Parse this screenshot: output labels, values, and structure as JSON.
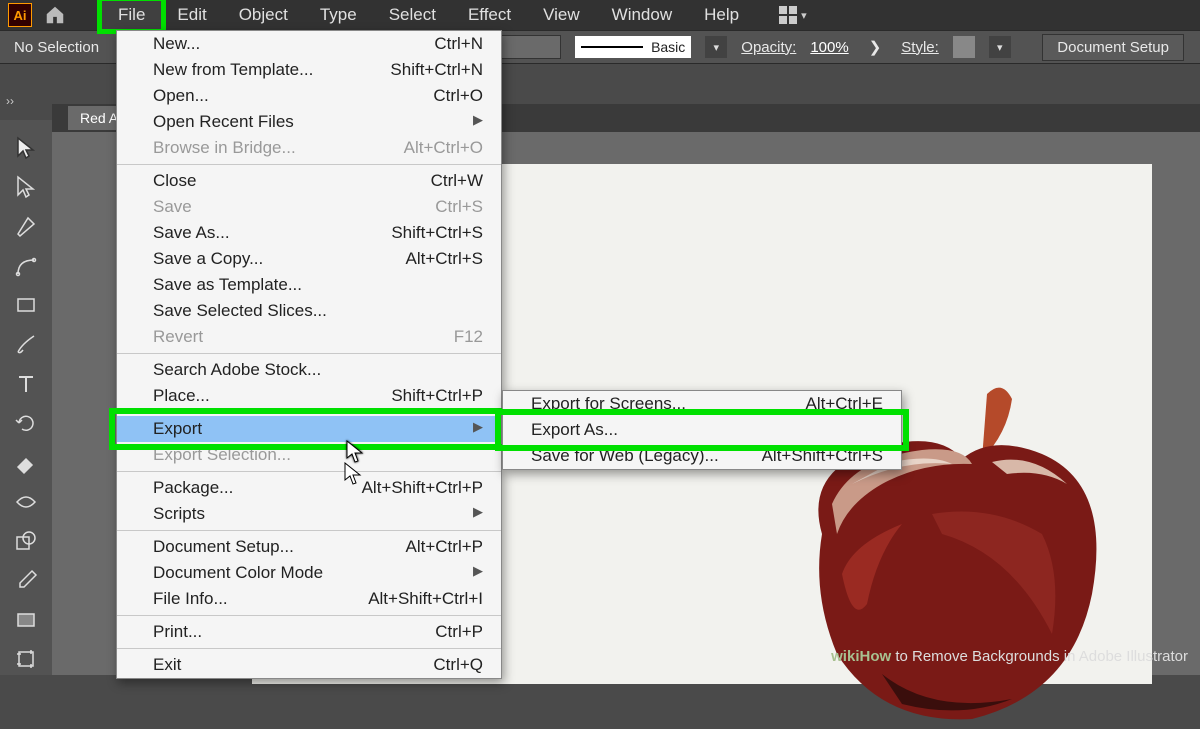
{
  "menubar": [
    "File",
    "Edit",
    "Object",
    "Type",
    "Select",
    "Effect",
    "View",
    "Window",
    "Help"
  ],
  "selection": "No Selection",
  "options": {
    "stroke_style": "Basic",
    "opacity_label": "Opacity:",
    "opacity_value": "100%",
    "style_label": "Style:",
    "doc_setup": "Document Setup"
  },
  "tab_name": "Red Ap",
  "file_menu": [
    {
      "label": "New...",
      "sc": "Ctrl+N"
    },
    {
      "label": "New from Template...",
      "sc": "Shift+Ctrl+N"
    },
    {
      "label": "Open...",
      "sc": "Ctrl+O"
    },
    {
      "label": "Open Recent Files",
      "sc": "",
      "arrow": true
    },
    {
      "label": "Browse in Bridge...",
      "sc": "Alt+Ctrl+O",
      "disabled": true
    },
    {
      "sep": true
    },
    {
      "label": "Close",
      "sc": "Ctrl+W"
    },
    {
      "label": "Save",
      "sc": "Ctrl+S",
      "disabled": true
    },
    {
      "label": "Save As...",
      "sc": "Shift+Ctrl+S"
    },
    {
      "label": "Save a Copy...",
      "sc": "Alt+Ctrl+S"
    },
    {
      "label": "Save as Template...",
      "sc": ""
    },
    {
      "label": "Save Selected Slices...",
      "sc": ""
    },
    {
      "label": "Revert",
      "sc": "F12",
      "disabled": true
    },
    {
      "sep": true
    },
    {
      "label": "Search Adobe Stock...",
      "sc": ""
    },
    {
      "label": "Place...",
      "sc": "Shift+Ctrl+P"
    },
    {
      "sep": true
    },
    {
      "label": "Export",
      "sc": "",
      "arrow": true,
      "hl": true
    },
    {
      "label": "Export Selection...",
      "sc": "",
      "disabled": true
    },
    {
      "sep": true
    },
    {
      "label": "Package...",
      "sc": "Alt+Shift+Ctrl+P"
    },
    {
      "label": "Scripts",
      "sc": "",
      "arrow": true
    },
    {
      "sep": true
    },
    {
      "label": "Document Setup...",
      "sc": "Alt+Ctrl+P"
    },
    {
      "label": "Document Color Mode",
      "sc": "",
      "arrow": true
    },
    {
      "label": "File Info...",
      "sc": "Alt+Shift+Ctrl+I"
    },
    {
      "sep": true
    },
    {
      "label": "Print...",
      "sc": "Ctrl+P"
    },
    {
      "sep": true
    },
    {
      "label": "Exit",
      "sc": "Ctrl+Q"
    }
  ],
  "export_submenu": [
    {
      "label": "Export for Screens...",
      "sc": "Alt+Ctrl+E"
    },
    {
      "label": "Export As...",
      "sc": "",
      "hl": true
    },
    {
      "label": "Save for Web (Legacy)...",
      "sc": "Alt+Shift+Ctrl+S"
    }
  ],
  "watermark": {
    "wiki": "wikiHow",
    "rest": " to Remove Backgrounds in Adobe Illustrator"
  }
}
